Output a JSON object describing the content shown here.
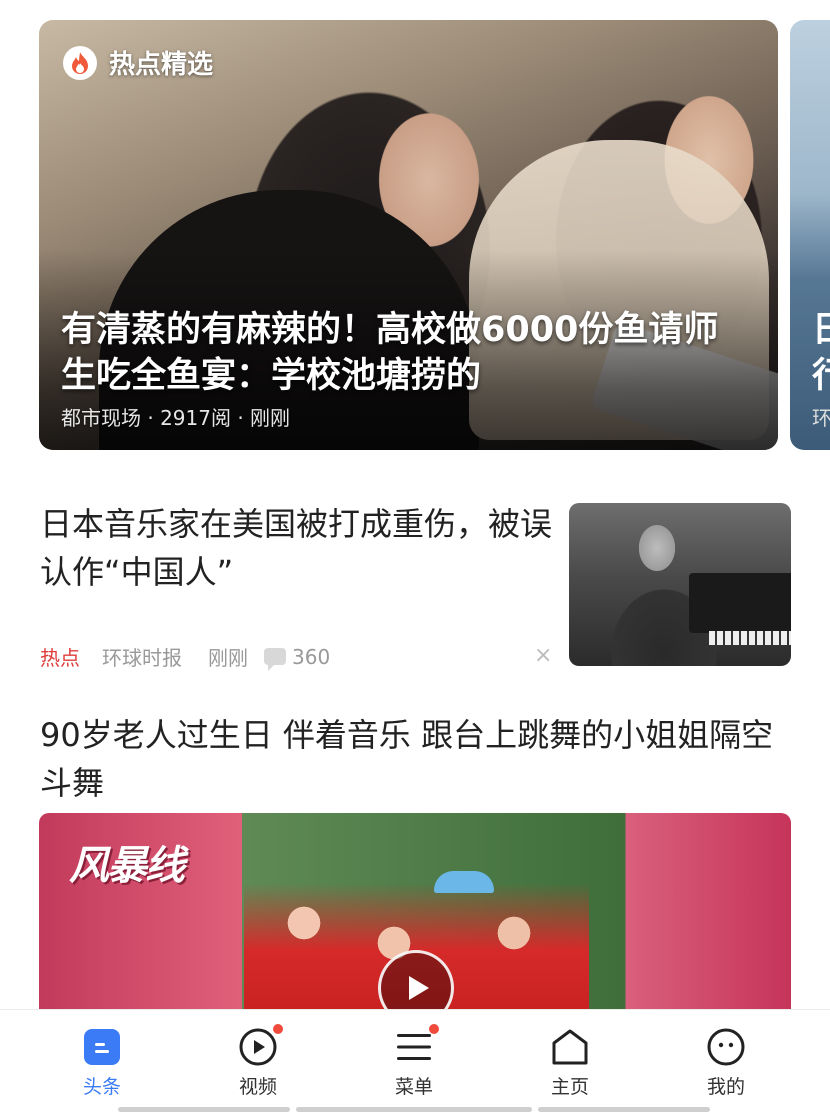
{
  "hot": {
    "badge_label": "热点精选",
    "title": "有清蒸的有麻辣的！高校做6000份鱼请师生吃全鱼宴：学校池塘捞的",
    "meta": "都市现场 · 2917阅 · 刚刚",
    "next_title_peek": "日\n行",
    "next_meta_peek": "环"
  },
  "article1": {
    "title": "日本音乐家在美国被打成重伤，被误认作“中国人”",
    "tag": "热点",
    "source": "环球时报",
    "time": "刚刚",
    "comments": "360",
    "dismiss": "×"
  },
  "article2": {
    "title": "90岁老人过生日 伴着音乐 跟台上跳舞的小姐姐隔空斗舞",
    "video_logo": "风暴线"
  },
  "tabs": [
    {
      "label": "头条",
      "icon": "headline-icon",
      "active": true,
      "badge": false
    },
    {
      "label": "视频",
      "icon": "video-play-icon",
      "active": false,
      "badge": true
    },
    {
      "label": "菜单",
      "icon": "menu-icon",
      "active": false,
      "badge": true
    },
    {
      "label": "主页",
      "icon": "home-icon",
      "active": false,
      "badge": false
    },
    {
      "label": "我的",
      "icon": "profile-face-icon",
      "active": false,
      "badge": false
    }
  ],
  "colors": {
    "accent": "#3b7bf6",
    "hot_tag": "#e03c3c",
    "badge_dot": "#f04a3a"
  }
}
